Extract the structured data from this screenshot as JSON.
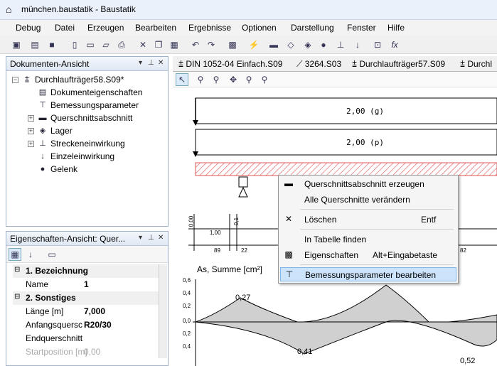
{
  "window": {
    "title": "münchen.baustatik - Baustatik"
  },
  "menu": [
    "Debug",
    "Datei",
    "Erzeugen",
    "Bearbeiten",
    "Ergebnisse",
    "Optionen",
    "Darstellung",
    "Fenster",
    "Hilfe"
  ],
  "doc_panel": {
    "title": "Dokumenten-Ansicht",
    "root": "Durchlaufträger58.S09*",
    "items": [
      "Dokumenteigenschaften",
      "Bemessungsparameter",
      "Querschnittsabschnitt",
      "Lager",
      "Streckeneinwirkung",
      "Einzeleinwirkung",
      "Gelenk"
    ]
  },
  "props_panel": {
    "title": "Eigenschaften-Ansicht:  Quer...",
    "sections": [
      {
        "name": "1. Bezeichnung"
      },
      {
        "name": "2. Sonstiges"
      }
    ],
    "rows": {
      "name_key": "Name",
      "name_val": "1",
      "laenge_key": "Länge [m]",
      "laenge_val": "7,000",
      "anfang_key": "Anfangsquersc",
      "anfang_val": "R20/30",
      "end_key": "Endquerschnitt",
      "end_val": "",
      "start_key": "Startposition [m]",
      "start_val": "0,00"
    }
  },
  "tabs": [
    "DIN 1052-04 Einfach.S09",
    "3264.S03",
    "Durchlaufträger57.S09",
    "Durchl"
  ],
  "canvas": {
    "load1": "2,00 (g)",
    "load2": "2,00 (p)",
    "dim_top": [
      "0,00",
      "1,00",
      "0,1"
    ],
    "dim_bottom": [
      "89",
      "22",
      "82"
    ],
    "yaxis_title": "As, Summe [cm²]",
    "yticks": [
      "0,6",
      "0,4",
      "0,2",
      "0,0",
      "0,2",
      "0,4",
      "0,6"
    ],
    "peak_labels": [
      "0,27",
      "0,41",
      "0,52"
    ]
  },
  "context_menu": [
    {
      "label": "Querschnittsabschnitt erzeugen",
      "shortcut": ""
    },
    {
      "label": "Alle Querschnitte verändern",
      "shortcut": ""
    },
    {
      "label": "Löschen",
      "shortcut": "Entf"
    },
    {
      "label": "In Tabelle finden",
      "shortcut": ""
    },
    {
      "label": "Eigenschaften",
      "shortcut": "Alt+Eingabetaste"
    },
    {
      "label": "Bemessungsparameter bearbeiten",
      "shortcut": ""
    }
  ],
  "colors": {
    "accent": "#3399ff",
    "hatch": "#e05050",
    "selection": "#cce4fb"
  }
}
